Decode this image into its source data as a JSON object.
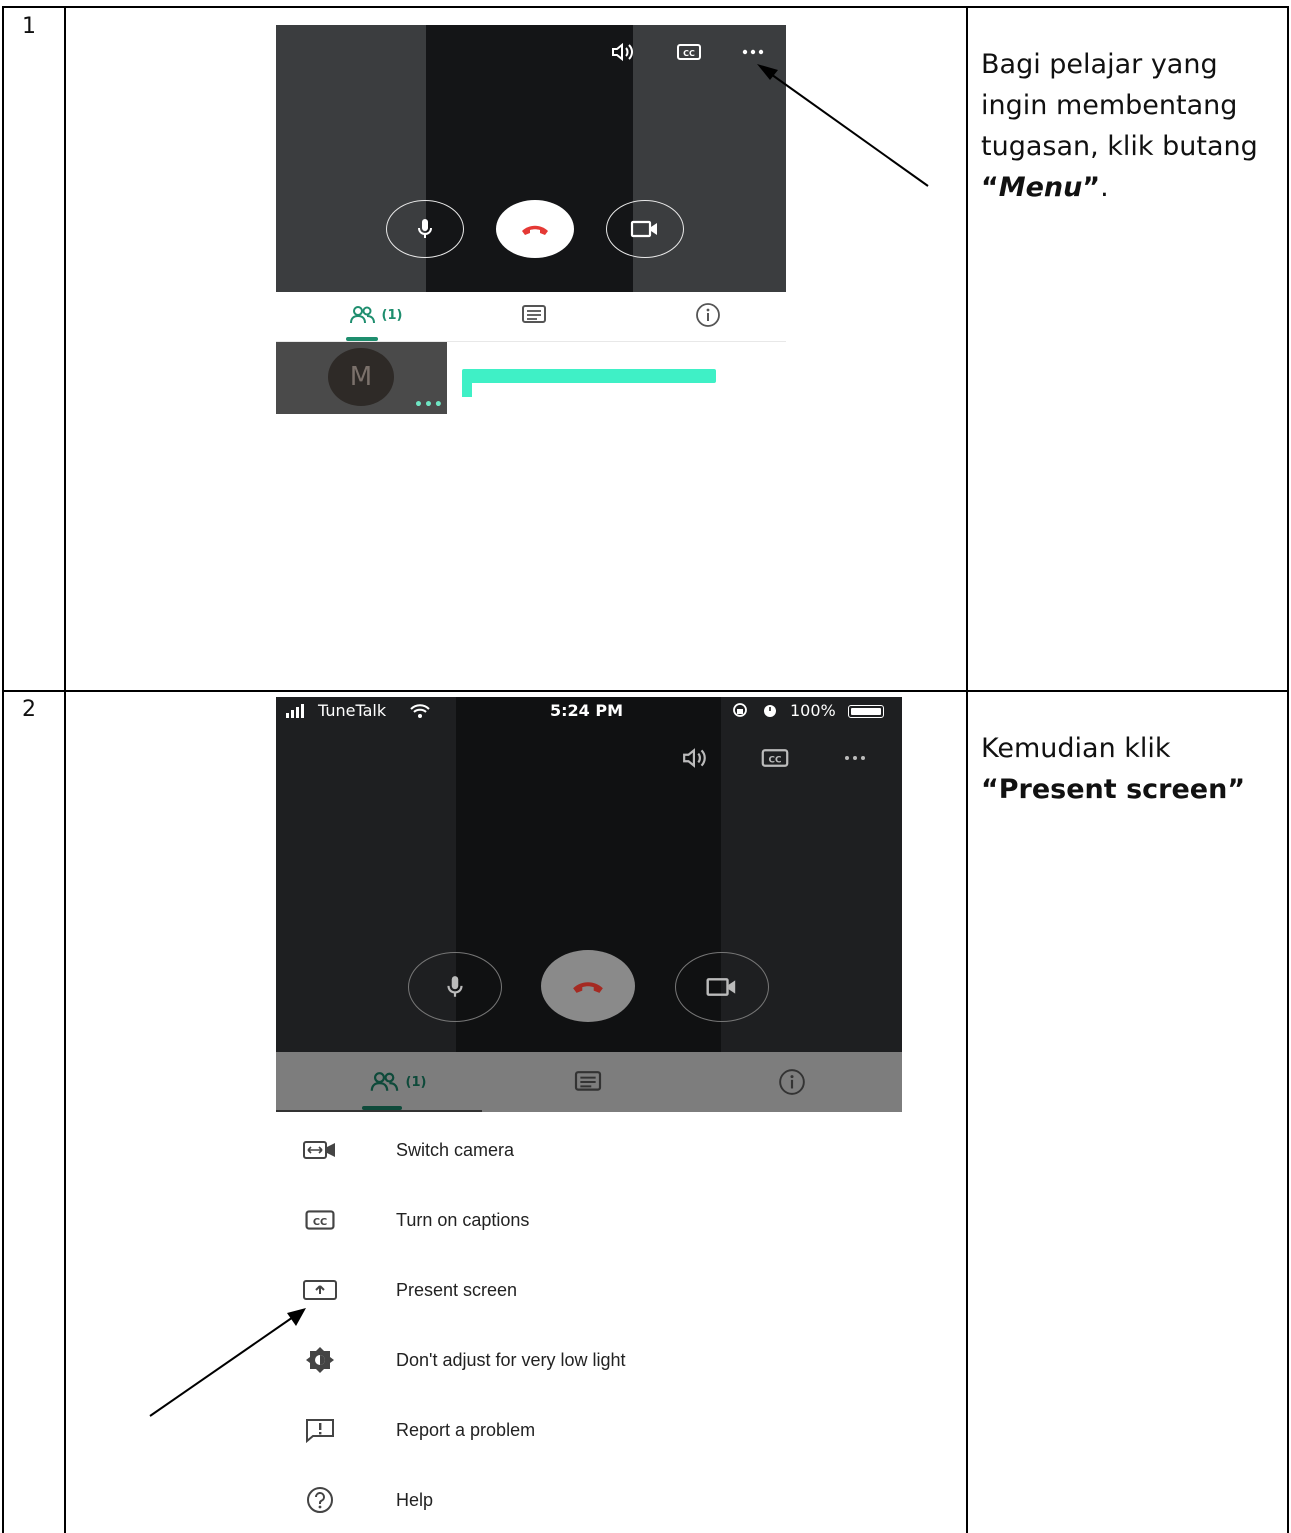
{
  "rows": [
    {
      "number": "1",
      "instruction": {
        "text_before": "Bagi pelajar yang ingin membentang tugasan, klik butang ",
        "open_quote": "“",
        "emphasis": "Menu",
        "close_quote": "”",
        "text_after": "."
      }
    },
    {
      "number": "2",
      "instruction": {
        "text_before": "Kemudian klik",
        "open_quote": "“",
        "emphasis": "Present screen",
        "close_quote": "”"
      }
    }
  ],
  "screenshot1": {
    "participants_count": "(1)",
    "avatar_letter": "M",
    "tile_more": "•••"
  },
  "screenshot2": {
    "status_bar": {
      "carrier": "TuneTalk",
      "time": "5:24 PM",
      "battery": "100%"
    },
    "participants_count": "(1)",
    "menu_items": [
      {
        "label": "Switch camera",
        "icon": "switch-camera-icon"
      },
      {
        "label": "Turn on captions",
        "icon": "captions-icon"
      },
      {
        "label": "Present screen",
        "icon": "present-screen-icon"
      },
      {
        "label": "Don't adjust for very low light",
        "icon": "low-light-icon"
      },
      {
        "label": "Report a problem",
        "icon": "report-problem-icon"
      },
      {
        "label": "Help",
        "icon": "help-icon"
      }
    ]
  }
}
